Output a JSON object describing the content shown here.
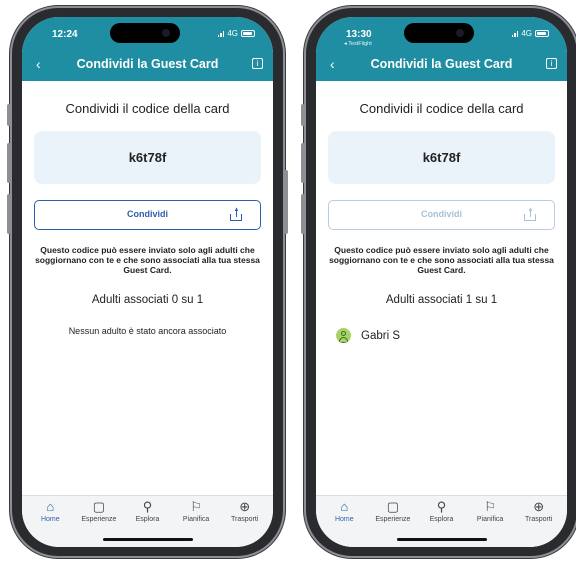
{
  "screens": [
    {
      "status_time": "12:24",
      "status_sub": "",
      "network": "4G",
      "nav_title": "Condividi la Guest Card",
      "content_title": "Condividi il codice della card",
      "code": "k6t78f",
      "share_label": "Condividi",
      "share_enabled": true,
      "description": "Questo codice può essere inviato solo agli adulti che soggiornano con te e che sono associati alla tua stessa Guest Card.",
      "adults_title": "Adulti associati 0 su 1",
      "empty_message": "Nessun adulto è stato ancora associato",
      "member_name": "",
      "tabs": [
        {
          "label": "Home",
          "icon": "home-icon",
          "glyph": "⌂",
          "active": true
        },
        {
          "label": "Esperienze",
          "icon": "ticket-icon",
          "glyph": "▢",
          "active": false
        },
        {
          "label": "Esplora",
          "icon": "explore-icon",
          "glyph": "⚲",
          "active": false
        },
        {
          "label": "Pianifica",
          "icon": "signpost-icon",
          "glyph": "⚐",
          "active": false
        },
        {
          "label": "Trasporti",
          "icon": "transport-icon",
          "glyph": "⊕",
          "active": false
        }
      ]
    },
    {
      "status_time": "13:30",
      "status_sub": "◂ TestFlight",
      "network": "4G",
      "nav_title": "Condividi la Guest Card",
      "content_title": "Condividi il codice della card",
      "code": "k6t78f",
      "share_label": "Condividi",
      "share_enabled": false,
      "description": "Questo codice può essere inviato solo agli adulti che soggiornano con te e che sono associati alla tua stessa Guest Card.",
      "adults_title": "Adulti associati 1 su 1",
      "empty_message": "",
      "member_name": "Gabri S",
      "tabs": [
        {
          "label": "Home",
          "icon": "home-icon",
          "glyph": "⌂",
          "active": true
        },
        {
          "label": "Esperienze",
          "icon": "ticket-icon",
          "glyph": "▢",
          "active": false
        },
        {
          "label": "Esplora",
          "icon": "explore-icon",
          "glyph": "⚲",
          "active": false
        },
        {
          "label": "Pianifica",
          "icon": "signpost-icon",
          "glyph": "⚐",
          "active": false
        },
        {
          "label": "Trasporti",
          "icon": "transport-icon",
          "glyph": "⊕",
          "active": false
        }
      ]
    }
  ],
  "colors": {
    "header": "#1f8ea2",
    "accent": "#2f5fa7",
    "code_box": "#eaf2fa",
    "avatar": "#a8d36a"
  }
}
